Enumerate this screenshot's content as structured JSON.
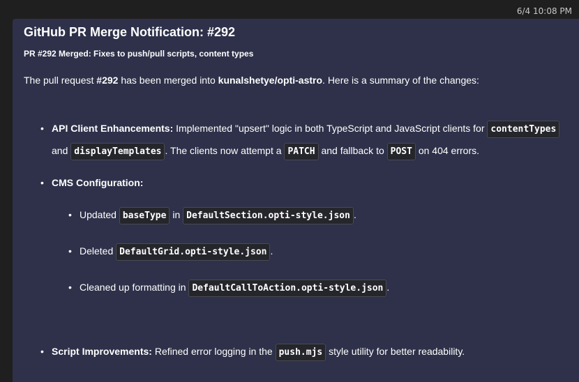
{
  "message": {
    "timestamp": "6/4 10:08 PM",
    "title": "GitHub PR Merge Notification: #292",
    "subtitle": "PR #292 Merged: Fixes to push/pull scripts, content types",
    "intro": {
      "p1": "The pull request ",
      "pr": "#292",
      "p2": " has been merged into ",
      "repo": "kunalshetye/opti-astro",
      "p3": ". Here is a summary of the changes:"
    },
    "items": {
      "api": {
        "label": "API Client Enhancements:",
        "t1": " Implemented \"upsert\" logic in both TypeScript and JavaScript clients for ",
        "c1": "contentTypes",
        "t2": " and ",
        "c2": "displayTemplates",
        "t3": ". The clients now attempt a ",
        "c3": "PATCH",
        "t4": " and fallback to ",
        "c4": "POST",
        "t5": " on 404 errors."
      },
      "cms": {
        "label": "CMS Configuration:",
        "sub1": {
          "t1": "Updated ",
          "c1": "baseType",
          "t2": " in ",
          "c2": "DefaultSection.opti-style.json",
          "t3": "."
        },
        "sub2": {
          "t1": "Deleted ",
          "c1": "DefaultGrid.opti-style.json",
          "t2": "."
        },
        "sub3": {
          "t1": "Cleaned up formatting in ",
          "c1": "DefaultCallToAction.opti-style.json",
          "t2": "."
        }
      },
      "script": {
        "label": "Script Improvements:",
        "t1": " Refined error logging in the ",
        "c1": "push.mjs",
        "t2": " style utility for better readability."
      }
    }
  }
}
